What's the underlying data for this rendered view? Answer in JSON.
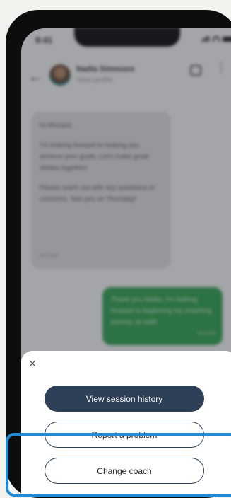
{
  "status_bar": {
    "time": "9:41"
  },
  "chat_header": {
    "back_icon": "arrow-left-icon",
    "name": "Nadia Simmons",
    "subtitle": "View profile"
  },
  "messages": {
    "incoming": {
      "greeting": "Hi Richard,",
      "body_1": "I'm looking forward to helping you achieve your goals. Let's make great strides together!",
      "body_2": "Please reach out with any questions or concerns. See you on Thursday!",
      "time": "09:12 AM"
    },
    "outgoing": {
      "text": "Thank you Nadia, I'm looking forward to beginning my coaching journey as well!",
      "time": "09:14 AM"
    }
  },
  "sheet": {
    "close_label": "×",
    "view_history": "View session history",
    "report_problem": "Report a problem",
    "change_coach": "Change coach"
  },
  "colors": {
    "primary": "#2e4057",
    "outgoing_bubble": "#34a853",
    "highlight": "#1f8ad8"
  }
}
